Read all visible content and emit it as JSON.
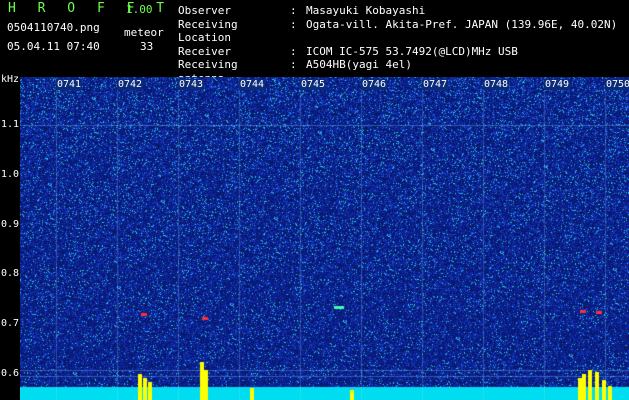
{
  "header": {
    "logo": "H R O F F T",
    "version": "1.00",
    "filename": "0504110740.png",
    "datetime": "05.04.11 07:40",
    "meteor_label": "meteor",
    "meteor_count": "33"
  },
  "info": [
    {
      "key": "Observer",
      "value": "Masayuki Kobayashi"
    },
    {
      "key": "Receiving Location",
      "value": "Ogata-vill. Akita-Pref. JAPAN (139.96E, 40.02N)"
    },
    {
      "key": "Receiver",
      "value": "ICOM IC-575 53.7492(@LCD)MHz USB"
    },
    {
      "key": "Receiving antenna",
      "value": "A504HB(yagi 4el)"
    }
  ],
  "axis": {
    "unit": "kHz",
    "y_ticks": [
      "1.1",
      "1.0",
      "0.9",
      "0.8",
      "0.7",
      "0.6"
    ],
    "time_ticks": [
      "0741",
      "0742",
      "0743",
      "0744",
      "0745",
      "0746",
      "0747",
      "0748",
      "0749",
      "0750"
    ]
  },
  "colors": {
    "background": "#000000",
    "spectrogram_base": "#0a1f7a",
    "accent_green": "#6bff4a",
    "baseline_cyan": "#00e5ff",
    "meteor_yellow": "#ffff00"
  }
}
